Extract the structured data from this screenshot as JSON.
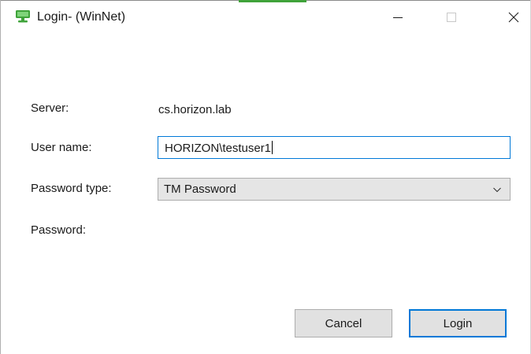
{
  "window": {
    "title": "Login- (WinNet)",
    "icon": "monitor-icon",
    "controls": {
      "minimize_icon": "minimize-icon",
      "maximize_icon": "maximize-icon",
      "close_icon": "close-icon"
    }
  },
  "form": {
    "server_label": "Server:",
    "server_value": "cs.horizon.lab",
    "username_label": "User name:",
    "username_value": "HORIZON\\testuser1",
    "password_type_label": "Password type:",
    "password_type_value": "TM Password",
    "password_label": "Password:"
  },
  "buttons": {
    "cancel_label": "Cancel",
    "login_label": "Login"
  },
  "colors": {
    "accent": "#0078d7",
    "app_icon": "#3fa33a"
  }
}
